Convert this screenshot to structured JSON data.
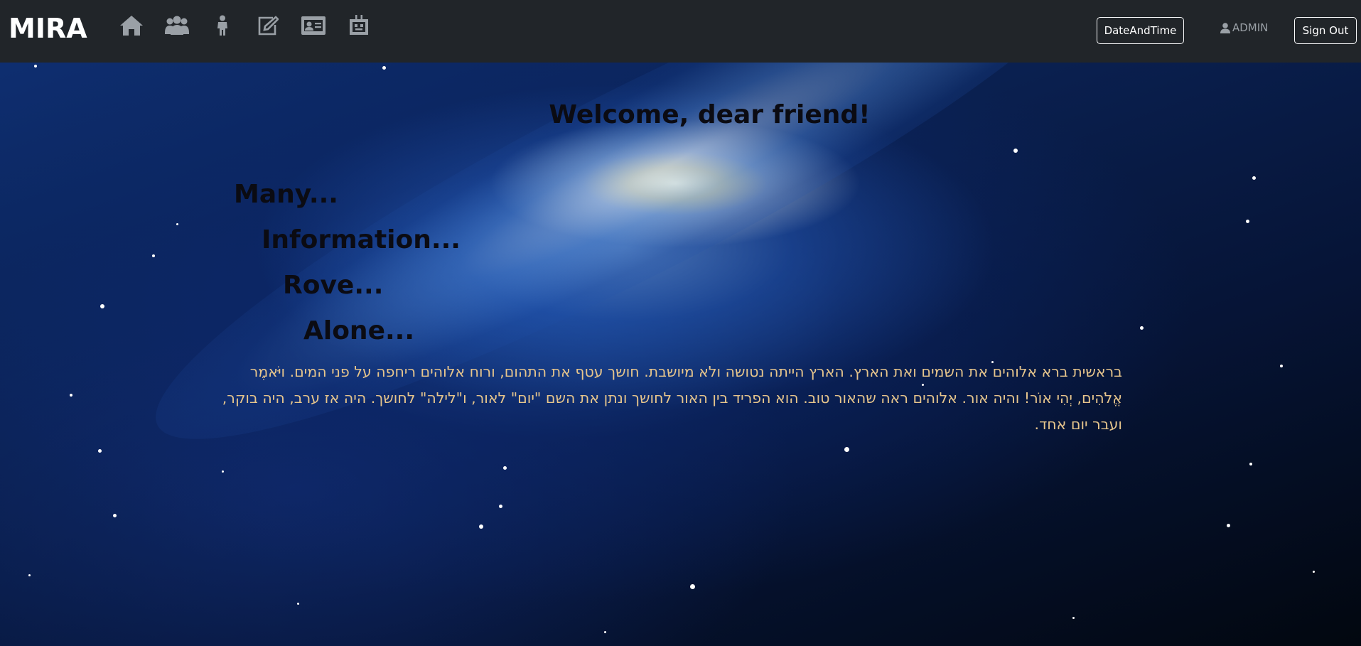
{
  "navbar": {
    "brand": "MIRA",
    "icons": [
      "home-icon",
      "group-icon",
      "person-icon",
      "edit-icon",
      "id-card-icon",
      "robot-icon"
    ],
    "date_button": "DateAndTime",
    "user_label": "ADMIN",
    "signout_button": "Sign Out"
  },
  "main": {
    "welcome": "Welcome, dear friend!",
    "words": [
      "Many...",
      "Information...",
      "Rove...",
      "Alone..."
    ],
    "hebrew_text": "בראשית ברא אלוהים את השמים ואת הארץ. הארץ הייתה נטושה ולא מיושבת. חושך עטף את התהום, ורוח אלוהים ריחפה על פני המים. ויֹּאמֶר אֱלֹהִים, יְהִי אוֹר! והיה אור. אלוהים ראה שהאור טוב. הוא הפריד בין האור לחושך ונתן את השם \"יום\" לאור, ו\"לילה\" לחושך. היה אז ערב, היה בוקר, ועבר יום אחד."
  },
  "colors": {
    "navbar_bg": "#212529",
    "brand": "#ffffff",
    "nav_icon": "#9aa0a6",
    "heading_text": "#0b0b12",
    "hebrew_text": "#e6c58c"
  }
}
